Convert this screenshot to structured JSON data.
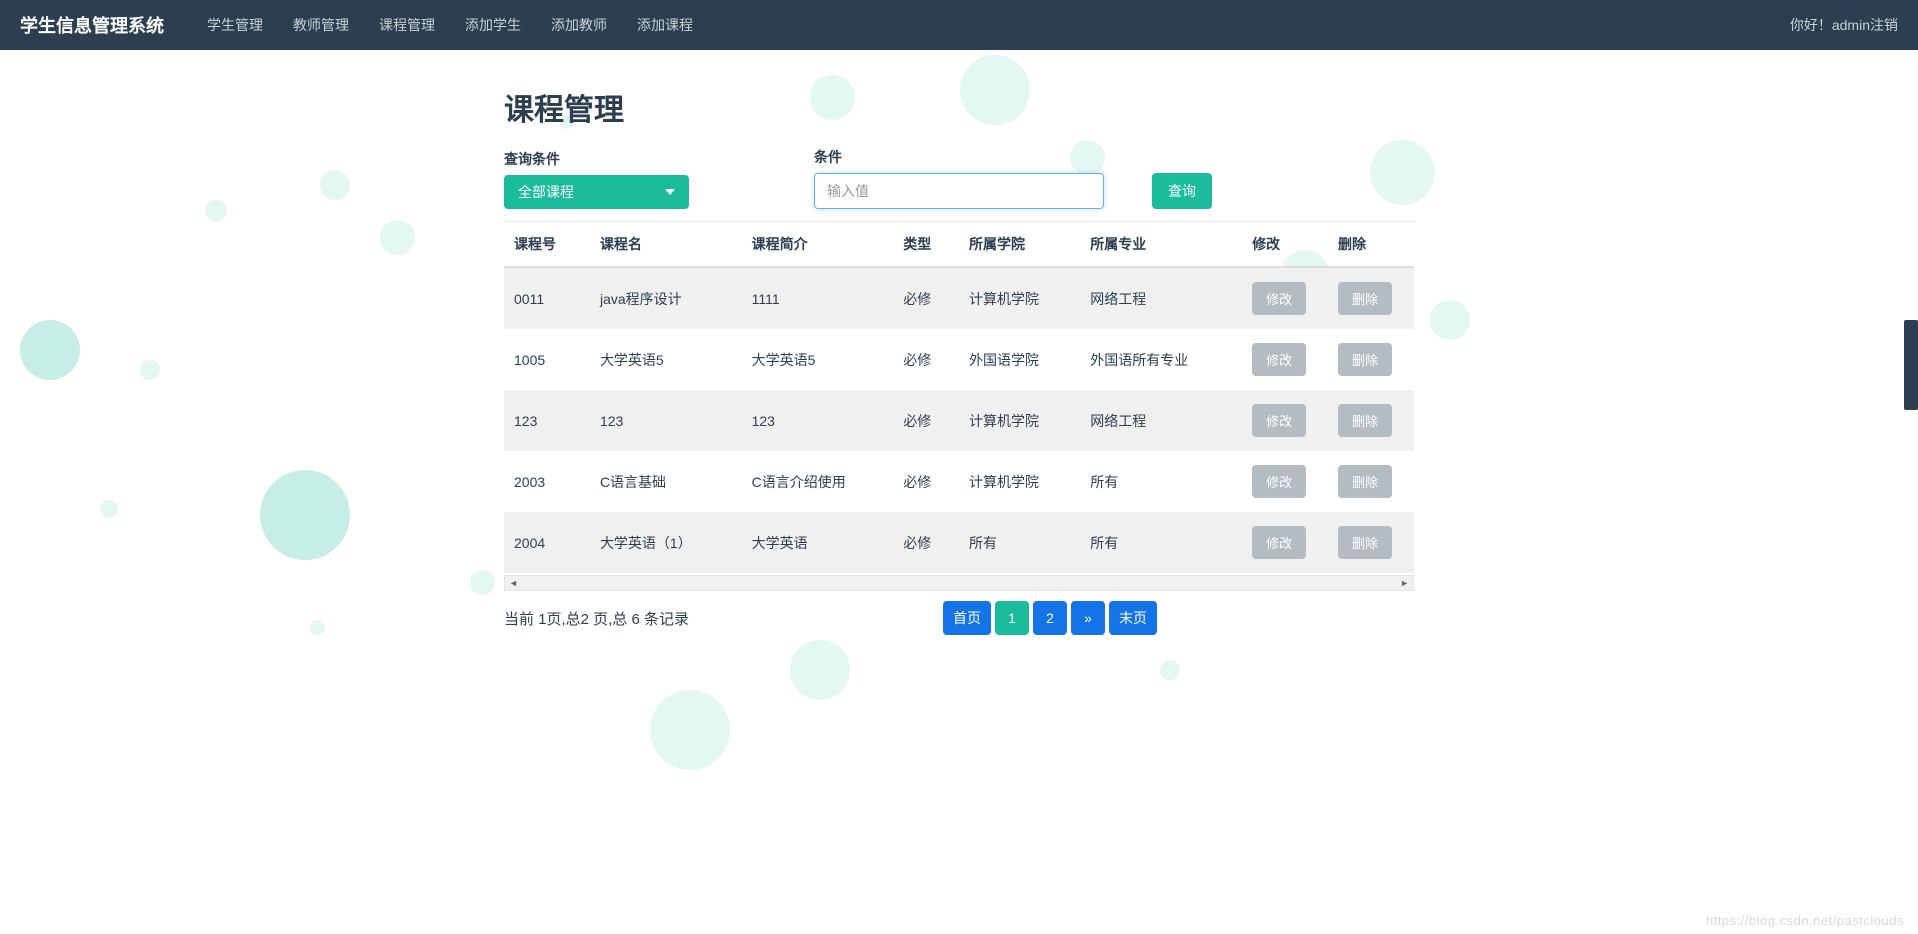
{
  "navbar": {
    "brand": "学生信息管理系统",
    "items": [
      {
        "label": "学生管理"
      },
      {
        "label": "教师管理"
      },
      {
        "label": "课程管理"
      },
      {
        "label": "添加学生"
      },
      {
        "label": "添加教师"
      },
      {
        "label": "添加课程"
      }
    ],
    "right_greeting": "你好！admin",
    "right_logout": "注销"
  },
  "page": {
    "title": "课程管理",
    "query_label": "查询条件",
    "dropdown_selected": "全部课程",
    "value_label": "条件",
    "value_placeholder": "输入值",
    "query_button": "查询"
  },
  "table": {
    "headers": [
      "课程号",
      "课程名",
      "课程简介",
      "类型",
      "所属学院",
      "所属专业",
      "修改",
      "删除"
    ],
    "rows": [
      {
        "id": "0011",
        "name": "java程序设计",
        "intro": "1111",
        "type": "必修",
        "college": "计算机学院",
        "major": "网络工程"
      },
      {
        "id": "1005",
        "name": "大学英语5",
        "intro": "大学英语5",
        "type": "必修",
        "college": "外国语学院",
        "major": "外国语所有专业"
      },
      {
        "id": "123",
        "name": "123",
        "intro": "123",
        "type": "必修",
        "college": "计算机学院",
        "major": "网络工程"
      },
      {
        "id": "2003",
        "name": "C语言基础",
        "intro": "C语言介绍使用",
        "type": "必修",
        "college": "计算机学院",
        "major": "所有"
      },
      {
        "id": "2004",
        "name": "大学英语（1）",
        "intro": "大学英语",
        "type": "必修",
        "college": "所有",
        "major": "所有"
      }
    ],
    "edit_label": "修改",
    "delete_label": "删除"
  },
  "pagination": {
    "info": "当前 1页,总2 页,总 6 条记录",
    "first": "首页",
    "p1": "1",
    "p2": "2",
    "next": "»",
    "last": "末页"
  },
  "watermark": "https://blog.csdn.net/pastclouds"
}
